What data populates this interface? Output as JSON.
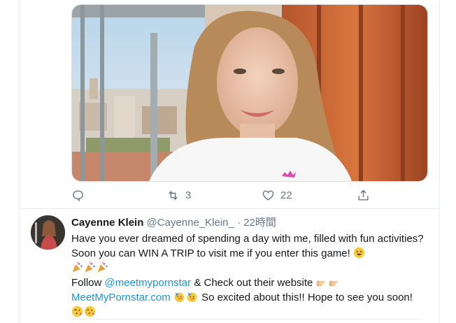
{
  "tweet1": {
    "actions": {
      "reply_count": "",
      "retweet_count": "3",
      "like_count": "22"
    }
  },
  "tweet2": {
    "display_name": "Cayenne Klein",
    "handle": "@Cayenne_Klein_",
    "separator": "·",
    "time": "22時間",
    "line1": "Have you ever dreamed of spending a day with me, filled with fun activities?",
    "line2_text": "Soon you can WIN A TRIP to visit me if you enter this game!",
    "follow_prefix": "Follow",
    "follow_link": "@meetmypornstar",
    "follow_suffix": "& Check out their website",
    "site_link": "MeetMyPornstar.com",
    "excited_text": "So excited about this!! Hope to see you soon!"
  },
  "colors": {
    "link": "#1b95e0",
    "secondary_text": "#657786",
    "border": "#e6ecf0"
  }
}
